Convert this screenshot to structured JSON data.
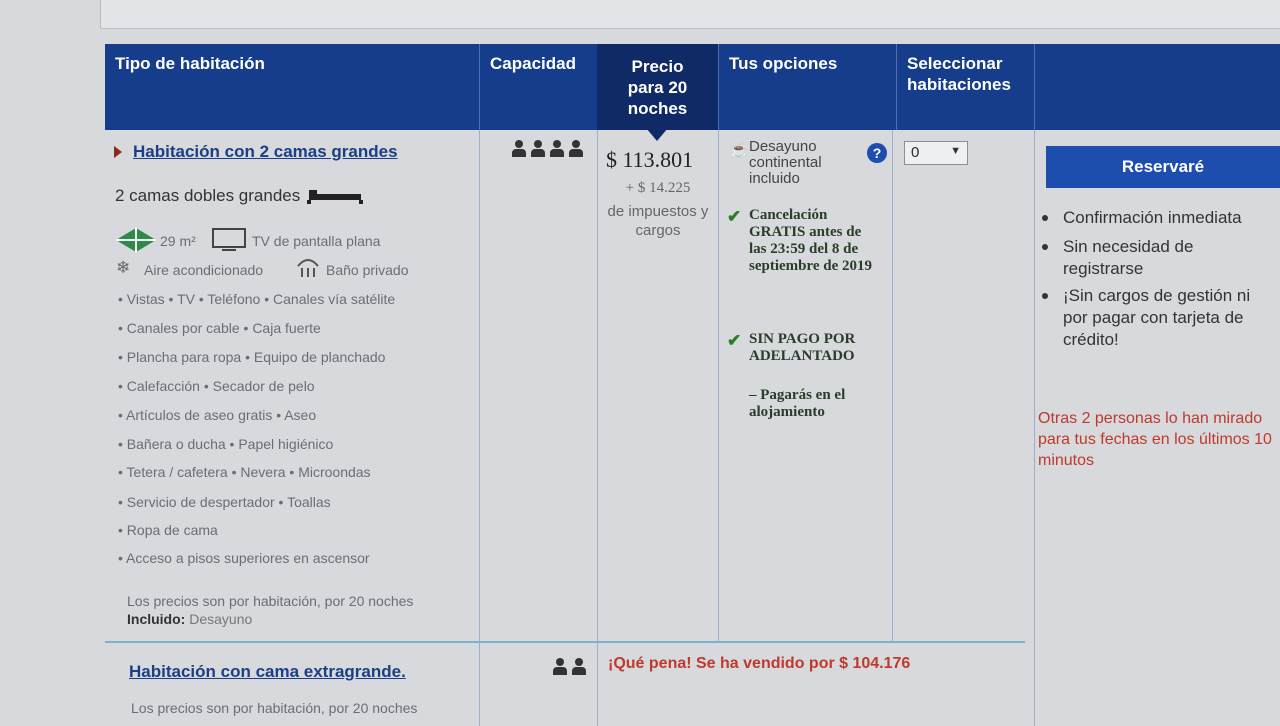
{
  "table_header": {
    "room_type": "Tipo de habitación",
    "capacity": "Capacidad",
    "price": "Precio para 20 noches",
    "options": "Tus opciones",
    "select_rooms": "Seleccionar habitaciones"
  },
  "room1": {
    "name": "Habitación con 2 camas grandes",
    "beds": "2 camas dobles grandes",
    "size": "29 m²",
    "tv": "TV de pantalla plana",
    "ac": "Aire acondicionado",
    "bath": "Baño privado",
    "amenity_lines": [
      "• Vistas   • TV   • Teléfono   • Canales vía satélite",
      "• Canales por cable   • Caja fuerte",
      "• Plancha para ropa   • Equipo de planchado",
      "• Calefacción   • Secador de pelo",
      "• Artículos de aseo gratis   • Aseo",
      "• Bañera o ducha   • Papel higiénico",
      "• Tetera / cafetera   • Nevera   • Microondas",
      "• Servicio de despertador   • Toallas",
      "• Ropa de cama",
      "• Acceso a pisos superiores en ascensor"
    ],
    "price_note": "Los precios son por habitación, por 20 noches",
    "included_label": "Incluido:",
    "included_value": "Desayuno",
    "capacity_count": 4,
    "price": "$ 113.801",
    "taxes_amount": "+ $ 14.225",
    "taxes_text": "de impuestos y cargos",
    "breakfast": "Desayuno continental incluido",
    "cancellation": "Cancelación GRATIS antes de las 23:59 del 8 de septiembre de 2019",
    "no_prepay": "SIN PAGO POR ADELANTADO",
    "pay_at_property": "– Pagarás en el alojamiento",
    "select_value": "0"
  },
  "sidebar": {
    "reserve_button": "Reservaré",
    "benefits": [
      "Confirmación inmediata",
      "Sin necesidad de registrarse",
      "¡Sin cargos de gestión ni por pagar con tarjeta de crédito!"
    ],
    "alert": "Otras 2 personas lo han mirado para tus fechas en los últimos 10 minutos"
  },
  "room2": {
    "name": "Habitación con cama extragrande.",
    "capacity_count": 2,
    "sold_out": "¡Qué pena! Se ha vendido por $ 104.176",
    "price_note": "Los precios son por habitación, por 20 noches"
  },
  "colors": {
    "header_blue": "#163d8c",
    "button_blue": "#1e4db0",
    "alert_red": "#c0392b",
    "check_green": "#2a7d2a"
  }
}
